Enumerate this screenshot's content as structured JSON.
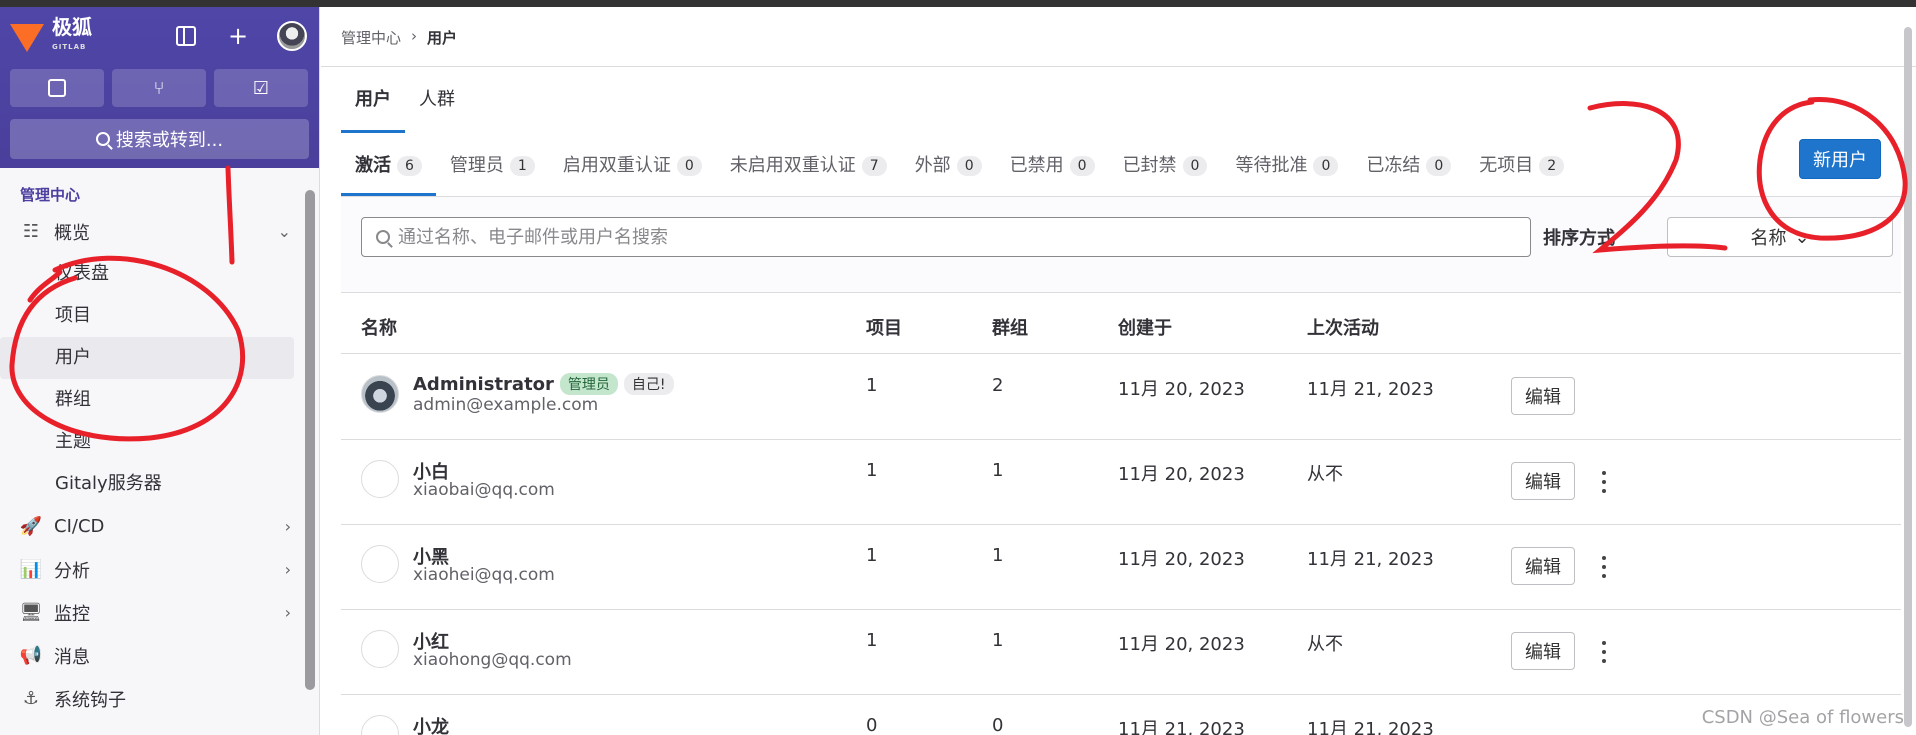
{
  "sidebar": {
    "brand": "极狐",
    "brand_sub": "GITLAB",
    "search_label": "搜索或转到...",
    "section": "管理中心",
    "overview": "概览",
    "sub_items": [
      "仪表盘",
      "项目",
      "用户",
      "群组",
      "主题",
      "Gitaly服务器"
    ],
    "items": [
      {
        "label": "CI/CD"
      },
      {
        "label": "分析"
      },
      {
        "label": "监控"
      },
      {
        "label": "消息"
      },
      {
        "label": "系统钩子"
      }
    ]
  },
  "breadcrumb": {
    "root": "管理中心",
    "current": "用户"
  },
  "top_tabs": [
    "用户",
    "人群"
  ],
  "state_tabs": [
    {
      "label": "激活",
      "count": "6"
    },
    {
      "label": "管理员",
      "count": "1"
    },
    {
      "label": "启用双重认证",
      "count": "0"
    },
    {
      "label": "未启用双重认证",
      "count": "7"
    },
    {
      "label": "外部",
      "count": "0"
    },
    {
      "label": "已禁用",
      "count": "0"
    },
    {
      "label": "已封禁",
      "count": "0"
    },
    {
      "label": "等待批准",
      "count": "0"
    },
    {
      "label": "已冻结",
      "count": "0"
    },
    {
      "label": "无项目",
      "count": "2"
    }
  ],
  "new_user_label": "新用户",
  "search": {
    "placeholder": "通过名称、电子邮件或用户名搜索",
    "value": ""
  },
  "sort": {
    "label": "排序方式",
    "value": "名称"
  },
  "table": {
    "headers": [
      "名称",
      "项目",
      "群组",
      "创建于",
      "上次活动"
    ],
    "edit_label": "编辑",
    "rows": [
      {
        "name": "Administrator",
        "admin_badge": "管理员",
        "self_badge": "自己!",
        "email": "admin@example.com",
        "projects": "1",
        "groups": "2",
        "created": "11月 20, 2023",
        "last": "11月 21, 2023"
      },
      {
        "name": "小白",
        "email": "xiaobai@qq.com",
        "projects": "1",
        "groups": "1",
        "created": "11月 20, 2023",
        "last": "从不"
      },
      {
        "name": "小黑",
        "email": "xiaohei@qq.com",
        "projects": "1",
        "groups": "1",
        "created": "11月 20, 2023",
        "last": "11月 21, 2023"
      },
      {
        "name": "小红",
        "email": "xiaohong@qq.com",
        "projects": "1",
        "groups": "1",
        "created": "11月 20, 2023",
        "last": "从不"
      },
      {
        "name": "小龙",
        "email": "",
        "projects": "0",
        "groups": "0",
        "created": "11月 21, 2023",
        "last": "11月 21, 2023"
      }
    ]
  },
  "annotation_number": "2",
  "watermark": "CSDN @Sea of flowers",
  "colors": {
    "sidebar_header": "#4a3f9b",
    "primary": "#1f75cb",
    "annotation": "#e8202a"
  }
}
